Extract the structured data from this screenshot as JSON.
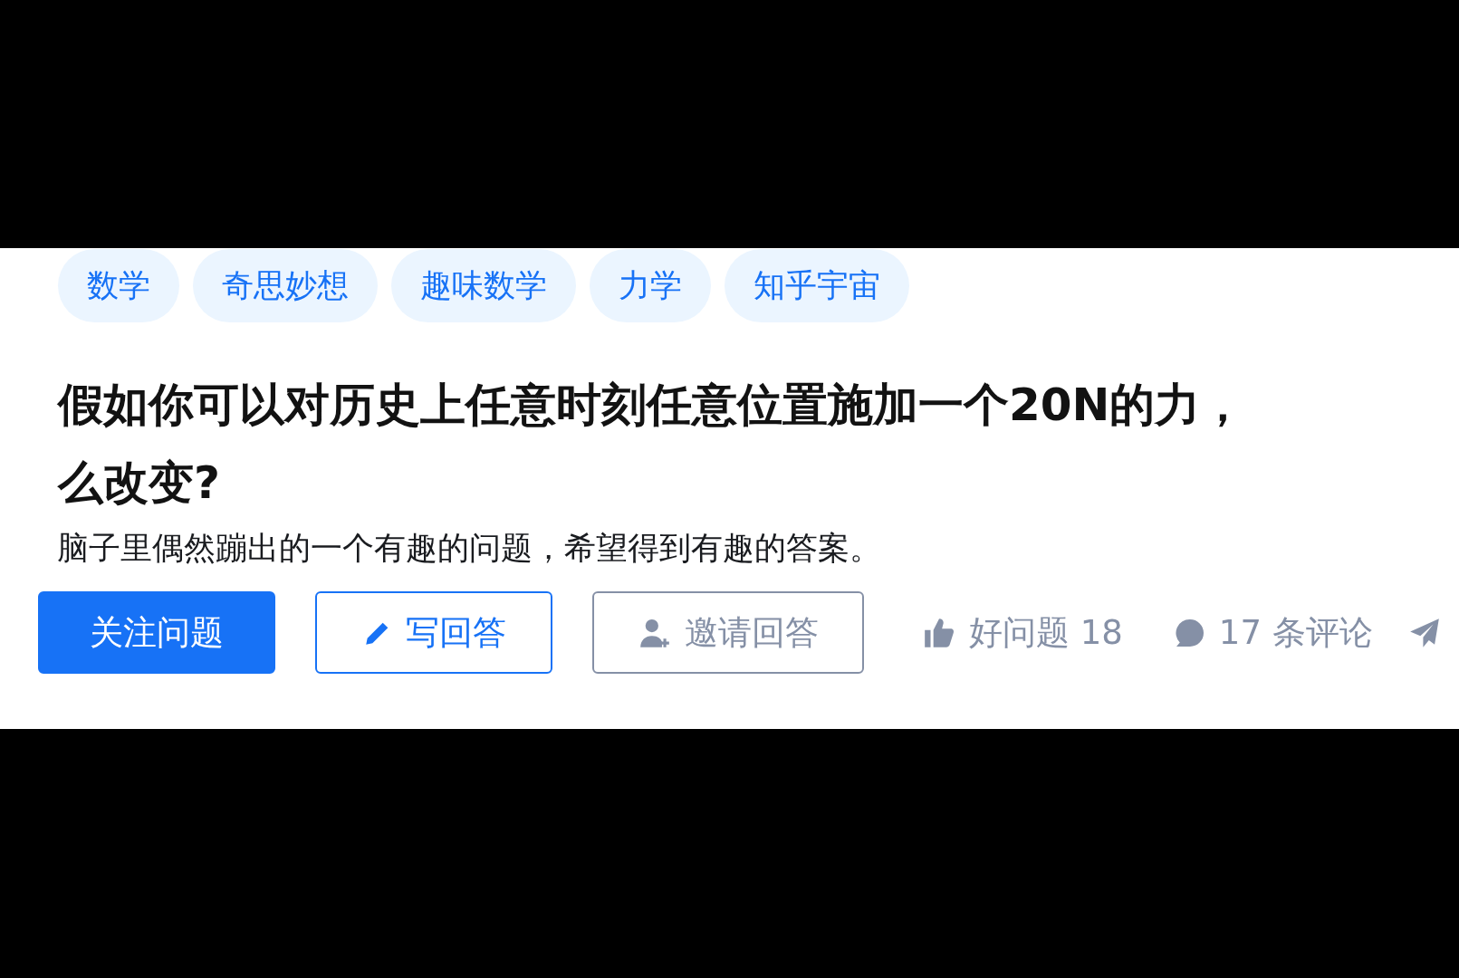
{
  "tags": [
    "数学",
    "奇思妙想",
    "趣味数学",
    "力学",
    "知乎宇宙"
  ],
  "title_lines": [
    "假如你可以对历史上任意时刻任意位置施加一个20N的力，",
    "么改变?"
  ],
  "description": "脑子里偶然蹦出的一个有趣的问题，希望得到有趣的答案。",
  "actions": [
    {
      "kind": "primary",
      "label": "关注问题"
    },
    {
      "kind": "outline",
      "label": "写回答"
    },
    {
      "kind": "ghost",
      "label": "邀请回答"
    }
  ],
  "stats": [
    {
      "kind": "like",
      "label": "好问题 18"
    },
    {
      "kind": "comment",
      "label": "17 条评论"
    },
    {
      "kind": "share"
    }
  ]
}
